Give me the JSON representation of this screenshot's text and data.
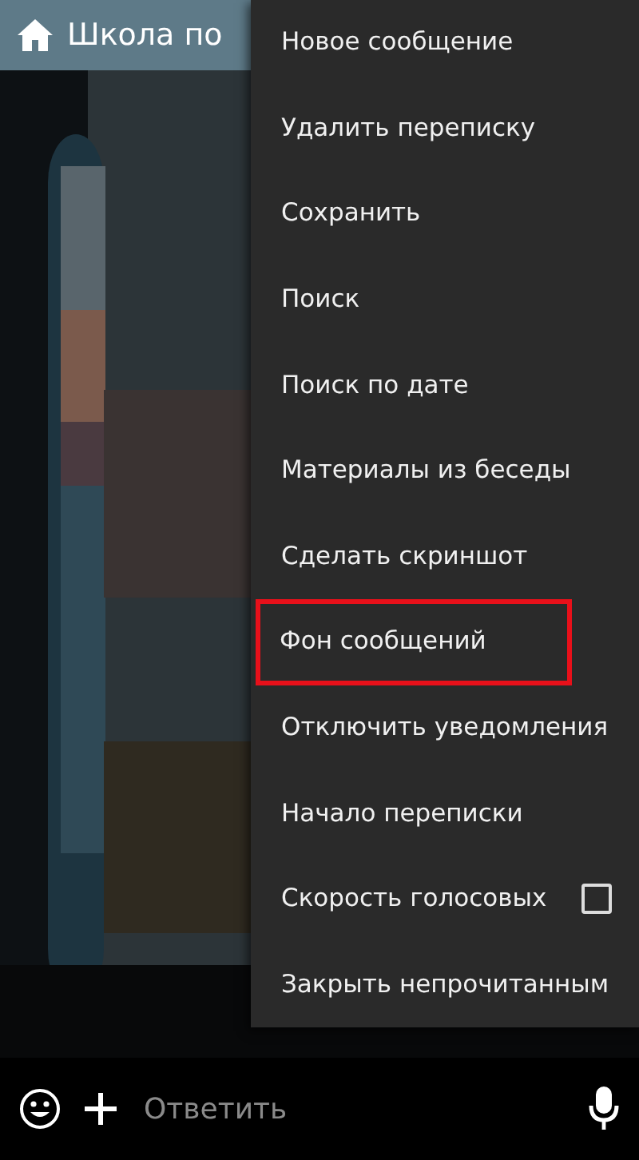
{
  "header": {
    "title": "Школа по"
  },
  "menu": {
    "items": [
      {
        "label": "Новое сообщение",
        "kind": "plain",
        "highlighted": false
      },
      {
        "label": "Удалить переписку",
        "kind": "plain",
        "highlighted": false
      },
      {
        "label": "Сохранить",
        "kind": "plain",
        "highlighted": false
      },
      {
        "label": "Поиск",
        "kind": "plain",
        "highlighted": false
      },
      {
        "label": "Поиск по дате",
        "kind": "plain",
        "highlighted": false
      },
      {
        "label": "Материалы из беседы",
        "kind": "plain",
        "highlighted": false
      },
      {
        "label": "Сделать скриншот",
        "kind": "plain",
        "highlighted": false
      },
      {
        "label": "Фон сообщений",
        "kind": "plain",
        "highlighted": true
      },
      {
        "label": "Отключить уведомления",
        "kind": "plain",
        "highlighted": false
      },
      {
        "label": "Начало переписки",
        "kind": "plain",
        "highlighted": false
      },
      {
        "label": "Скорость голосовых",
        "kind": "checkbox",
        "checked": false,
        "highlighted": false
      },
      {
        "label": "Закрыть непрочитанным",
        "kind": "plain",
        "highlighted": false
      }
    ]
  },
  "composer": {
    "placeholder": "Ответить"
  }
}
